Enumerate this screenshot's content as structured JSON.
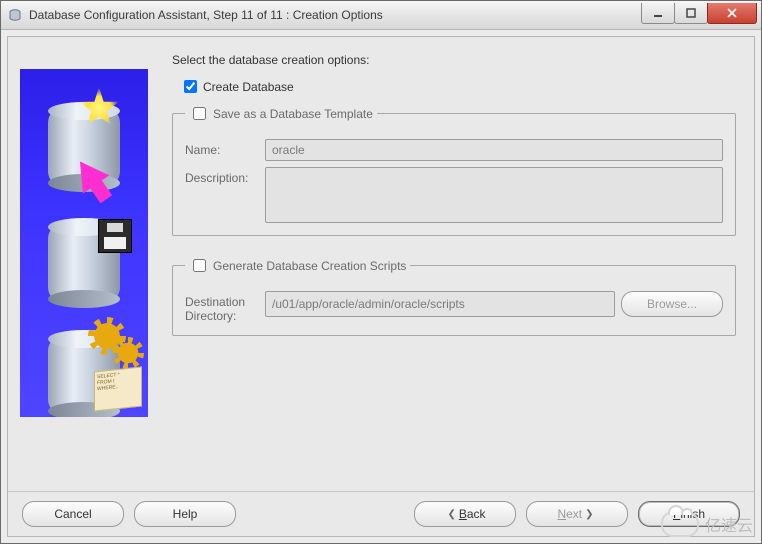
{
  "window": {
    "title": "Database Configuration Assistant, Step 11 of 11 : Creation Options"
  },
  "prompt": "Select the database creation options:",
  "create_db": {
    "label": "Create Database",
    "checked": true
  },
  "save_template": {
    "legend": "Save as a Database Template",
    "checked": false,
    "name_label": "Name:",
    "name_value": "oracle",
    "desc_label": "Description:",
    "desc_value": ""
  },
  "gen_scripts": {
    "legend": "Generate Database Creation Scripts",
    "checked": false,
    "dest_label": "Destination Directory:",
    "dest_value": "/u01/app/oracle/admin/oracle/scripts",
    "browse_label": "Browse..."
  },
  "buttons": {
    "cancel": "Cancel",
    "help": "Help",
    "back": "Back",
    "next": "Next",
    "finish": "Finish"
  },
  "watermark": "亿速云"
}
